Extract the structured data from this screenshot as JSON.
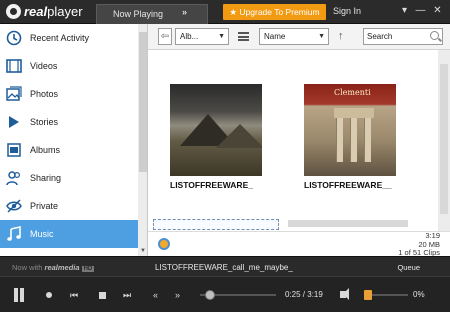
{
  "app": {
    "logo_text_bold": "real",
    "logo_text": "player"
  },
  "header": {
    "tab_now_playing": "Now Playing",
    "tab_more": "»",
    "upgrade_label": "★ Upgrade To Premium",
    "signin_label": "Sign In",
    "window_controls": [
      "▾",
      "—",
      "✕"
    ]
  },
  "sidebar": {
    "items": [
      {
        "label": "Recent Activity",
        "icon": "clock-icon"
      },
      {
        "label": "Videos",
        "icon": "film-icon"
      },
      {
        "label": "Photos",
        "icon": "photo-icon"
      },
      {
        "label": "Stories",
        "icon": "stories-play-icon"
      },
      {
        "label": "Albums",
        "icon": "album-icon"
      },
      {
        "label": "Sharing",
        "icon": "users-icon"
      },
      {
        "label": "Private",
        "icon": "eye-hidden-icon"
      },
      {
        "label": "Music",
        "icon": "music-note-icon",
        "active": true
      }
    ]
  },
  "toolbar": {
    "back": "⇦",
    "album_select": "Alb...",
    "sort_select": "Name",
    "sort_direction": "↑",
    "search_placeholder": "Search"
  },
  "albums": [
    {
      "caption": "LISTOFFREEWARE_",
      "cover_text": ""
    },
    {
      "caption": "LISTOFFREEWARE__",
      "cover_text": "Clementi"
    }
  ],
  "info": {
    "duration": "3:19",
    "size": "20 MB",
    "clips": "1 of 51 Clips"
  },
  "nowplaying": {
    "now_with": "Now with",
    "brand": "realmedia",
    "hd": "HD",
    "track": "LISTOFFREEWARE_call_me_maybe_",
    "queue": "Queue"
  },
  "transport": {
    "prev": "⏮",
    "next": "⏭",
    "rewind": "«",
    "forward": "»",
    "time": "0:25 / 3:19",
    "progress_fraction": 0.125,
    "volume_label": "0%",
    "volume_fraction": 0
  },
  "colors": {
    "accent": "#4e9fe1",
    "upgrade": "#f39a13",
    "volume": "#e8a035"
  }
}
